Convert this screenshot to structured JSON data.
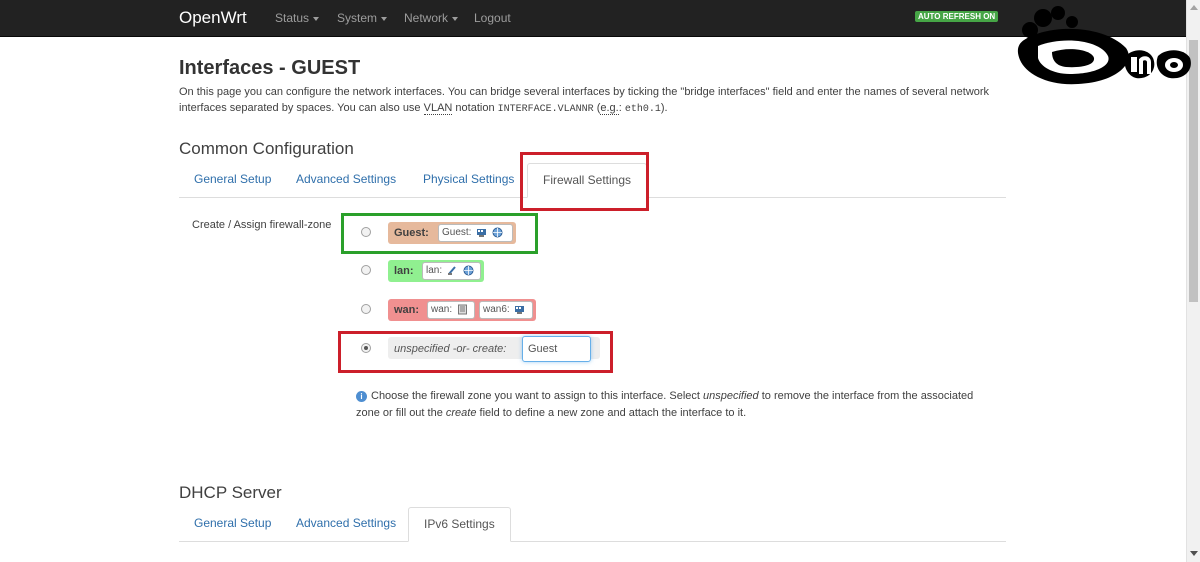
{
  "navbar": {
    "brand": "OpenWrt",
    "menu": [
      {
        "label": "Status",
        "has_dropdown": true
      },
      {
        "label": "System",
        "has_dropdown": true
      },
      {
        "label": "Network",
        "has_dropdown": true
      },
      {
        "label": "Logout",
        "has_dropdown": false
      }
    ],
    "auto_refresh": "AUTO REFRESH ON"
  },
  "logo_text": "DINO",
  "page": {
    "title": "Interfaces - GUEST",
    "desc_1": "On this page you can configure the network interfaces. You can bridge several interfaces by ticking the \"bridge interfaces\" field and enter the names of several network interfaces separated by spaces. You can also use ",
    "desc_vlan": "VLAN",
    "desc_2": " notation ",
    "desc_code1": "INTERFACE.VLANNR",
    "desc_3": " (",
    "desc_eg": "e.g.",
    "desc_4": ": ",
    "desc_code2": "eth0.1",
    "desc_5": ")."
  },
  "common": {
    "heading": "Common Configuration",
    "tabs": [
      "General Setup",
      "Advanced Settings",
      "Physical Settings",
      "Firewall Settings"
    ],
    "active_tab": "Firewall Settings"
  },
  "firewall": {
    "label": "Create / Assign firewall-zone",
    "zones": [
      {
        "name": "Guest:",
        "color": "#e6b99c",
        "networks": [
          {
            "label": "Guest:",
            "icons": [
              "wifi-network-icon",
              "globe-icon"
            ]
          }
        ],
        "selected": false
      },
      {
        "name": "lan:",
        "color": "#90f090",
        "networks": [
          {
            "label": "lan:",
            "icons": [
              "ethernet-icon",
              "globe-icon"
            ]
          }
        ],
        "selected": false
      },
      {
        "name": "wan:",
        "color": "#f09090",
        "networks": [
          {
            "label": "wan:",
            "icons": [
              "device-icon"
            ]
          },
          {
            "label": "wan6:",
            "icons": [
              "wifi-network-icon"
            ]
          }
        ],
        "selected": false
      }
    ],
    "unspecified_label": "unspecified -or- create:",
    "create_value": "Guest",
    "unspecified_selected": true,
    "help_1": "Choose the firewall zone you want to assign to this interface. Select ",
    "help_em1": "unspecified",
    "help_2": " to remove the interface from the associated zone or fill out the ",
    "help_em2": "create",
    "help_3": " field to define a new zone and attach the interface to it."
  },
  "dhcp": {
    "heading": "DHCP Server",
    "tabs": [
      "General Setup",
      "Advanced Settings",
      "IPv6 Settings"
    ],
    "active_tab": "IPv6 Settings"
  },
  "colors": {
    "highlight_red": "#cc1f2a",
    "highlight_green": "#2aa02a",
    "link": "#2f6fab",
    "auto_refresh": "#46a546"
  }
}
